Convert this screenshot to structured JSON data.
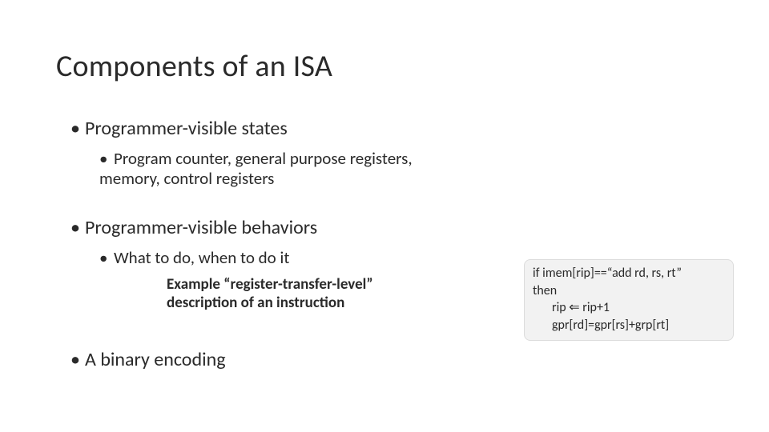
{
  "title": "Components of an ISA",
  "bullets": {
    "b1": "Programmer-visible states",
    "b1a": "Program counter, general purpose registers, memory, control registers",
    "b2": "Programmer-visible behaviors",
    "b2a": "What to do, when to do it",
    "note1": "Example “register-transfer-level”",
    "note2": "description of an instruction",
    "b3": "A binary encoding"
  },
  "code": {
    "l1": "if imem[rip]==“add rd, rs, rt”",
    "l2": "then",
    "l3": "rip ⇐ rip+1",
    "l4": "gpr[rd]=gpr[rs]+grp[rt]"
  }
}
